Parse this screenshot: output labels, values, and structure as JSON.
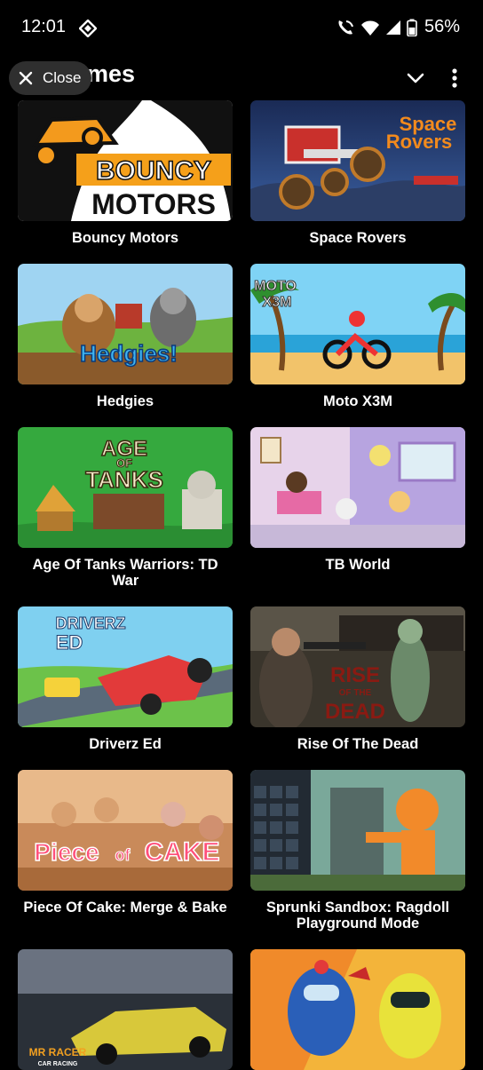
{
  "status_bar": {
    "time": "12:01",
    "battery": "56%",
    "icons": [
      "diamond-notification-icon",
      "wifi-calling-icon",
      "wifi-icon",
      "signal-icon",
      "battery-icon"
    ]
  },
  "header": {
    "title_partial": "mes",
    "close_label": "Close",
    "icons": [
      "close-icon",
      "chevron-down-icon",
      "more-vert-icon"
    ]
  },
  "games": [
    {
      "title": "Bouncy Motors",
      "art_text": [
        "BOUNCY",
        "MOTORS"
      ]
    },
    {
      "title": "Space Rovers",
      "art_text": [
        "Space",
        "Rovers"
      ]
    },
    {
      "title": "Hedgies",
      "art_text": [
        "Hedgies!"
      ]
    },
    {
      "title": "Moto X3M",
      "art_text": [
        "MOTO",
        "X3M"
      ]
    },
    {
      "title": "Age Of Tanks Warriors: TD War",
      "art_text": [
        "AGE",
        "OF",
        "TANKS"
      ]
    },
    {
      "title": "TB World",
      "art_text": []
    },
    {
      "title": "Driverz Ed",
      "art_text": [
        "DRIVERZ",
        "ED"
      ]
    },
    {
      "title": "Rise Of The Dead",
      "art_text": [
        "RISE",
        "OF THE",
        "DEAD"
      ]
    },
    {
      "title": "Piece Of Cake: Merge & Bake",
      "art_text": [
        "Piece",
        "of",
        "CAKE"
      ]
    },
    {
      "title": "Sprunki Sandbox: Ragdoll Playground Mode",
      "art_text": []
    },
    {
      "title": "",
      "art_text": [
        "MR RACER",
        "CAR RACING"
      ]
    },
    {
      "title": "",
      "art_text": []
    }
  ]
}
